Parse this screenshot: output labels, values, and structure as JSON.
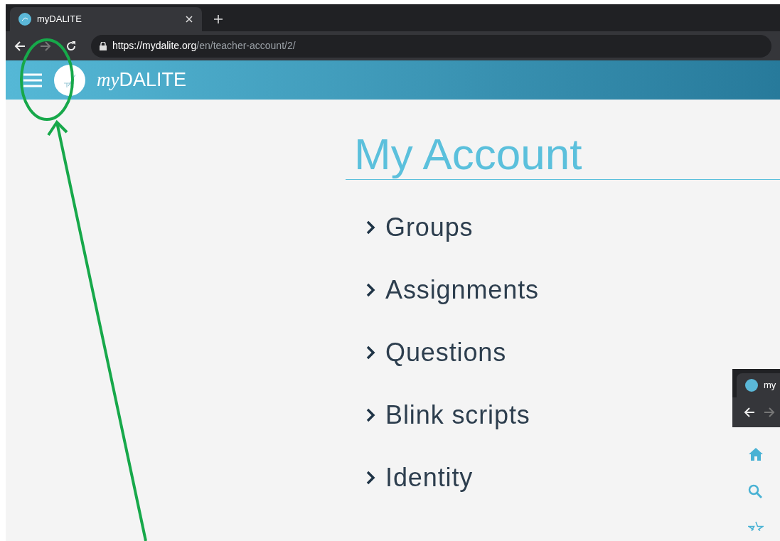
{
  "browser": {
    "tab_title": "myDALITE",
    "url_host": "https://mydalite.org",
    "url_path": "/en/teacher-account/2/"
  },
  "header": {
    "brand_prefix": "my",
    "brand_name": "DALITE"
  },
  "page": {
    "title": "My Account",
    "items": [
      "Groups",
      "Assignments",
      "Questions",
      "Blink scripts",
      "Identity"
    ]
  },
  "inset": {
    "tab_title": "my"
  }
}
